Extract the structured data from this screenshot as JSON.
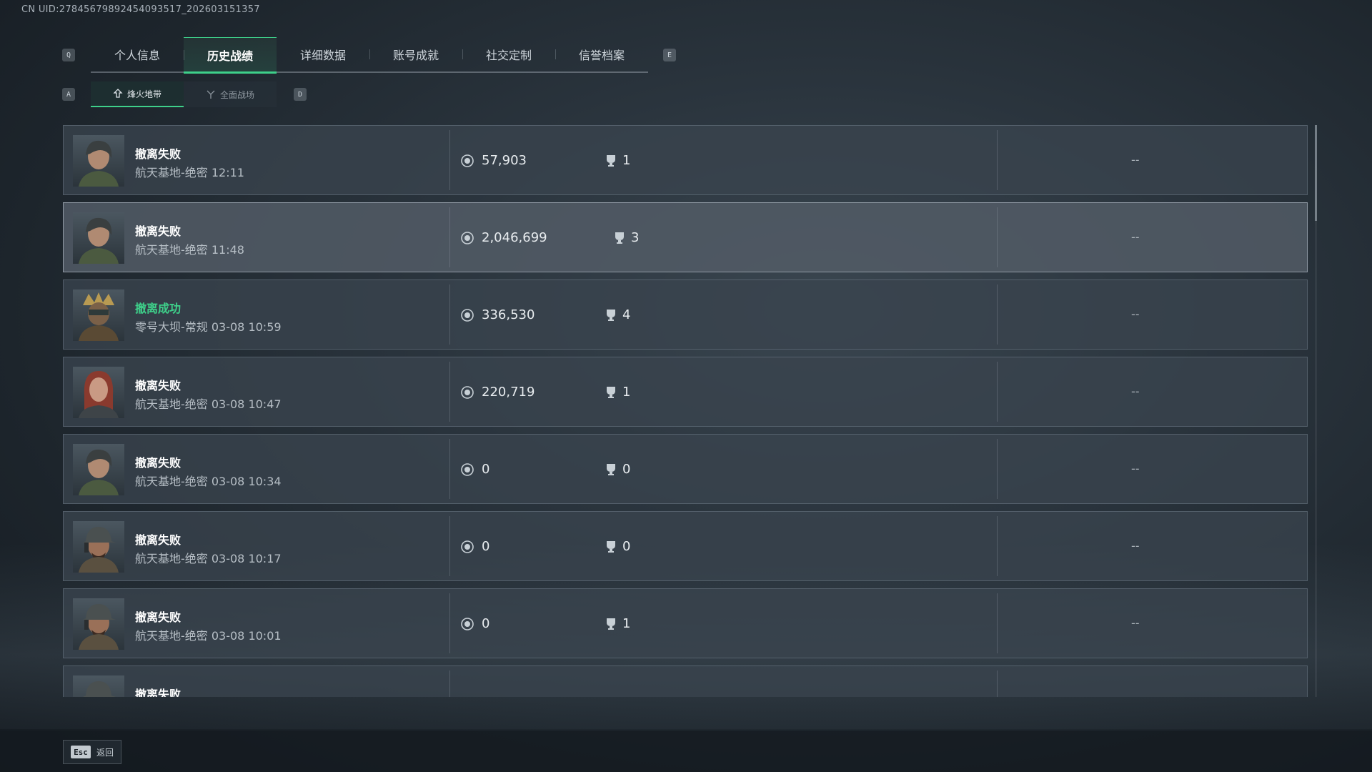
{
  "header": {
    "uid": "CN UID:2784567989245409351​7_202603151357"
  },
  "tabs": {
    "prev_key": "Q",
    "next_key": "E",
    "items": [
      {
        "label": "个人信息"
      },
      {
        "label": "历史战绩"
      },
      {
        "label": "详细数据"
      },
      {
        "label": "账号成就"
      },
      {
        "label": "社交定制"
      },
      {
        "label": "信誉档案"
      }
    ],
    "active": "历史战绩"
  },
  "subtabs": {
    "prev_key": "A",
    "next_key": "D",
    "items": [
      {
        "label": "烽火地带"
      },
      {
        "label": "全面战场"
      }
    ],
    "active": "烽火地带"
  },
  "matches": [
    {
      "status": "撤离失败",
      "detail": "航天基地-绝密 12:11",
      "money": "57,903",
      "kills": "1",
      "extra": "--"
    },
    {
      "status": "撤离失败",
      "detail": "航天基地-绝密 11:48",
      "money": "2,046,699",
      "kills": "3",
      "extra": "--"
    },
    {
      "status": "撤离成功",
      "detail": "零号大坝-常规 03-08 10:59",
      "money": "336,530",
      "kills": "4",
      "extra": "--"
    },
    {
      "status": "撤离失败",
      "detail": "航天基地-绝密 03-08 10:47",
      "money": "220,719",
      "kills": "1",
      "extra": "--"
    },
    {
      "status": "撤离失败",
      "detail": "航天基地-绝密 03-08 10:34",
      "money": "0",
      "kills": "0",
      "extra": "--"
    },
    {
      "status": "撤离失败",
      "detail": "航天基地-绝密 03-08 10:17",
      "money": "0",
      "kills": "0",
      "extra": "--"
    },
    {
      "status": "撤离失败",
      "detail": "航天基地-绝密 03-08 10:01",
      "money": "0",
      "kills": "1",
      "extra": "--"
    },
    {
      "status": "撤离失败",
      "detail": "",
      "money": "",
      "kills": "",
      "extra": ""
    }
  ],
  "footer": {
    "esc_key": "Esc",
    "back_label": "返回"
  },
  "colors": {
    "accent": "#3ed08a",
    "success": "#3ed08a"
  }
}
